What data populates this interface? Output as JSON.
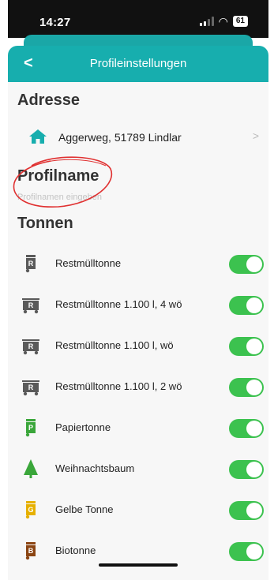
{
  "status_bar": {
    "time": "14:27",
    "battery": "61"
  },
  "header": {
    "back_label": "<",
    "title": "Profileinstellungen"
  },
  "address": {
    "section_title": "Adresse",
    "value": "Aggerweg, 51789 Lindlar",
    "chevron": ">"
  },
  "profile": {
    "section_title": "Profilname",
    "placeholder": "Profilnamen eingeben"
  },
  "bins": {
    "section_title": "Tonnen",
    "items": [
      {
        "label": "Restmülltonne",
        "icon": "gray-bin-icon",
        "letter": "R",
        "color": "#5a5a5a",
        "enabled": true
      },
      {
        "label": "Restmülltonne 1.100 l, 4 wö",
        "icon": "gray-container-icon",
        "letter": "R",
        "color": "#5a5a5a",
        "enabled": true
      },
      {
        "label": "Restmülltonne 1.100 l, wö",
        "icon": "gray-container-icon",
        "letter": "R",
        "color": "#5a5a5a",
        "enabled": true
      },
      {
        "label": "Restmülltonne 1.100 l, 2 wö",
        "icon": "gray-container-icon",
        "letter": "R",
        "color": "#5a5a5a",
        "enabled": true
      },
      {
        "label": "Papiertonne",
        "icon": "green-bin-icon",
        "letter": "P",
        "color": "#3aa63a",
        "enabled": true
      },
      {
        "label": "Weihnachtsbaum",
        "icon": "christmas-tree-icon",
        "letter": "",
        "color": "#3aa63a",
        "enabled": true
      },
      {
        "label": "Gelbe Tonne",
        "icon": "yellow-bin-icon",
        "letter": "G",
        "color": "#e6b000",
        "enabled": true
      },
      {
        "label": "Biotonne",
        "icon": "brown-bin-icon",
        "letter": "B",
        "color": "#8b4513",
        "enabled": true
      }
    ]
  },
  "colors": {
    "teal": "#17aeae",
    "toggle_on": "#3cc24f",
    "annotation": "#e03030"
  }
}
